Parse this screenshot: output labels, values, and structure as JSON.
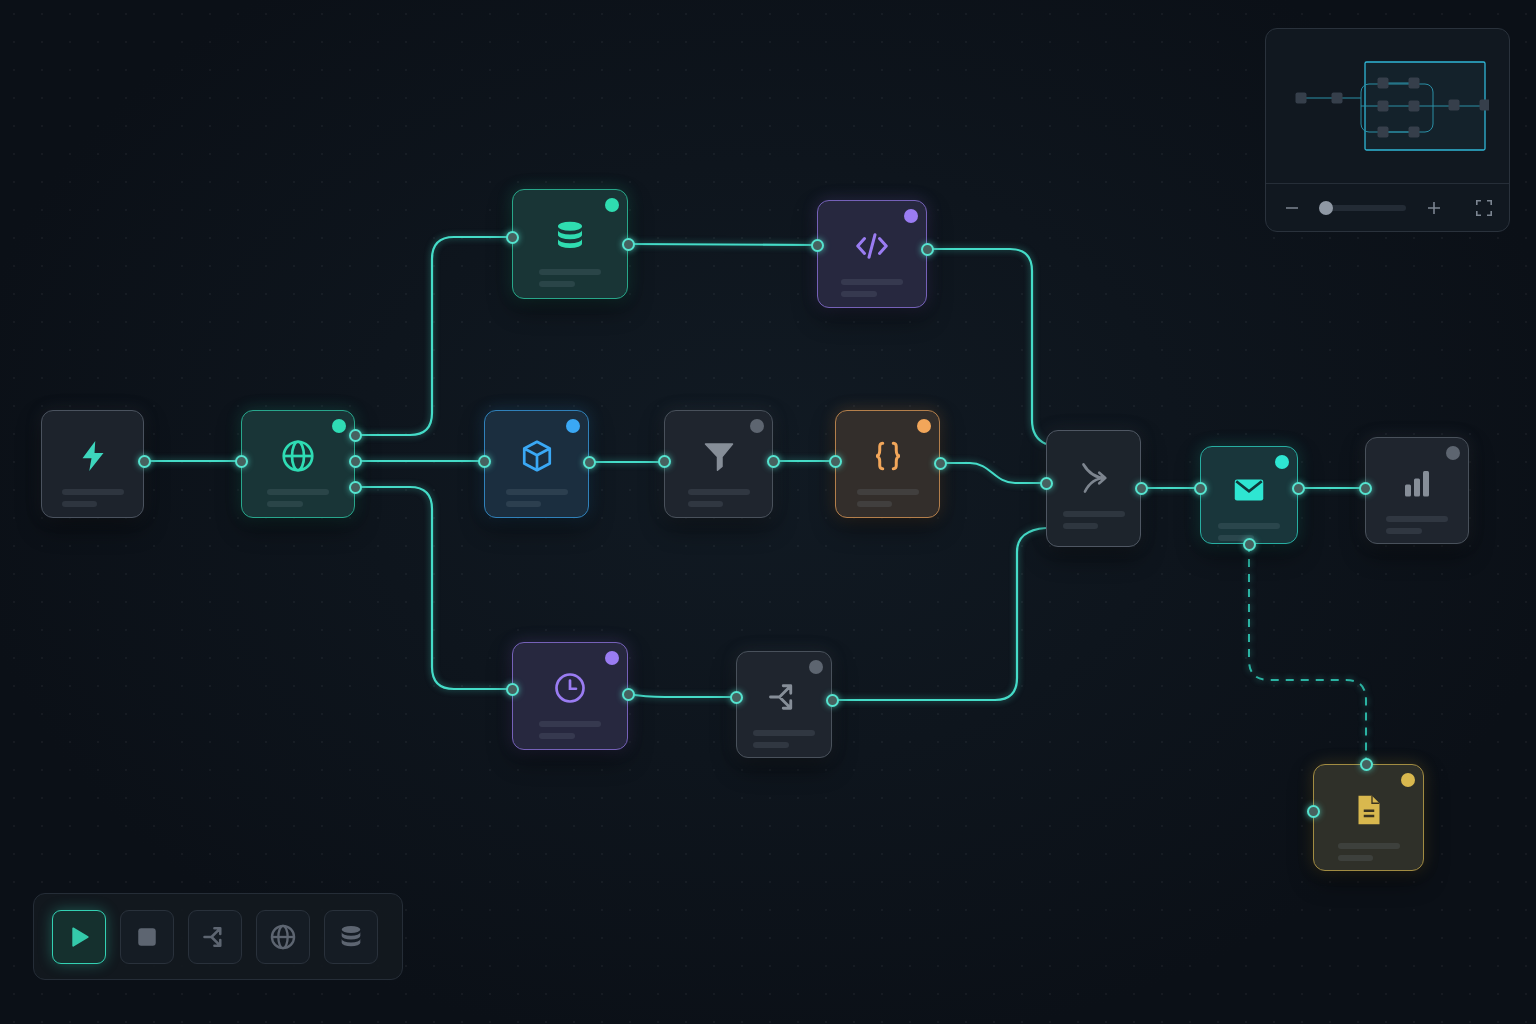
{
  "nodes": [
    {
      "kind": "trigger",
      "color": "#4a525e",
      "dot": false
    },
    {
      "kind": "http",
      "color": "#2fdcb4",
      "dot": true
    },
    {
      "kind": "database",
      "color": "#2fdcb0",
      "dot": true
    },
    {
      "kind": "code",
      "color": "#9a7cf2",
      "dot": true
    },
    {
      "kind": "module",
      "color": "#3aa8f5",
      "dot": true
    },
    {
      "kind": "filter",
      "color": "#5d6570",
      "dot": true
    },
    {
      "kind": "transform",
      "color": "#f2a65a",
      "dot": true
    },
    {
      "kind": "merge",
      "color": "#4f5763",
      "dot": false
    },
    {
      "kind": "email",
      "color": "#2ee6d2",
      "dot": true
    },
    {
      "kind": "chart",
      "color": "#5d6570",
      "dot": true
    },
    {
      "kind": "schedule",
      "color": "#9a7cf2",
      "dot": true
    },
    {
      "kind": "split",
      "color": "#5d6570",
      "dot": true
    },
    {
      "kind": "document",
      "color": "#d9b84e",
      "dot": true
    }
  ],
  "links": [
    {
      "kind": "solid"
    },
    {
      "kind": "solid"
    },
    {
      "kind": "solid"
    },
    {
      "kind": "solid"
    },
    {
      "kind": "solid"
    },
    {
      "kind": "solid"
    },
    {
      "kind": "solid"
    },
    {
      "kind": "solid"
    },
    {
      "kind": "solid"
    },
    {
      "kind": "solid"
    },
    {
      "kind": "solid"
    },
    {
      "kind": "solid"
    },
    {
      "kind": "solid"
    },
    {
      "kind": "dashed"
    }
  ],
  "toolbar": [
    {
      "kind": "play",
      "selected": true
    },
    {
      "kind": "stop",
      "selected": false
    },
    {
      "kind": "branch",
      "selected": false
    },
    {
      "kind": "globe",
      "selected": false
    },
    {
      "kind": "database",
      "selected": false
    }
  ],
  "minimap": {
    "zoom": {
      "level": 0.08
    }
  }
}
